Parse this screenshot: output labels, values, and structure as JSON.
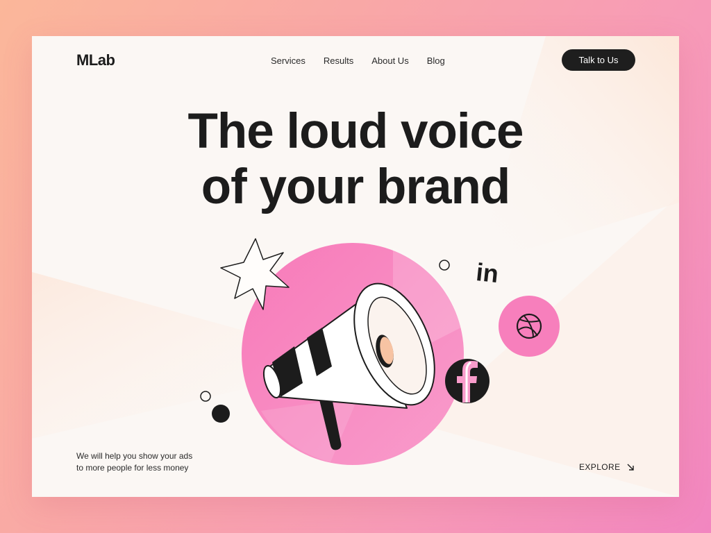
{
  "brand": {
    "logo": "MLab"
  },
  "nav": {
    "items": [
      "Services",
      "Results",
      "About Us",
      "Blog"
    ]
  },
  "header": {
    "cta_label": "Talk to Us"
  },
  "hero": {
    "headline_line1": "The loud voice",
    "headline_line2": "of your brand",
    "tagline_line1": "We will help you show your ads",
    "tagline_line2": "to more people for less money",
    "explore_label": "EXPLORE",
    "social_icons": [
      "linkedin-icon",
      "dribbble-icon",
      "facebook-icon"
    ]
  },
  "colors": {
    "accent_pink": "#f77fbc",
    "dark": "#1e1e1e",
    "card_bg": "#fbf7f4",
    "page_gradient": [
      "#fbb79a",
      "#f286c0"
    ]
  }
}
